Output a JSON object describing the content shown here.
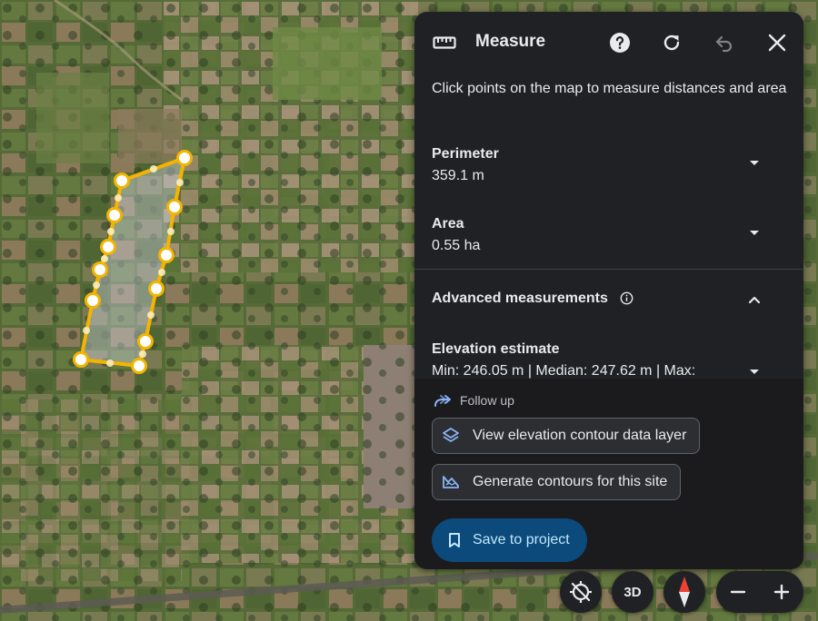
{
  "panel": {
    "title": "Measure",
    "instructions": "Click points on the map to measure distances and area",
    "perimeter": {
      "label": "Perimeter",
      "value": "359.1 m"
    },
    "area": {
      "label": "Area",
      "value": "0.55 ha"
    },
    "advanced": {
      "label": "Advanced measurements"
    },
    "elevation": {
      "label": "Elevation estimate",
      "value": "Min: 246.05 m | Median: 247.62 m | Max:"
    },
    "follow_up": "Follow up",
    "actions": {
      "view_contour": "View elevation contour data layer",
      "generate_contours": "Generate contours for this site",
      "save": "Save to project"
    }
  },
  "controls": {
    "three_d": "3D"
  },
  "colors": {
    "panel_bg": "#202124",
    "measure_line": "#f4b400",
    "save_button": "#0b4a7a",
    "save_text": "#c2e7ff",
    "compass_red": "#ea4335"
  },
  "icons": [
    "ruler-icon",
    "help-icon",
    "refresh-icon",
    "undo-icon",
    "close-icon",
    "chevron-down-icon",
    "chevron-up-icon",
    "info-icon",
    "follow-up-icon",
    "layers-icon",
    "contour-icon",
    "bookmark-icon",
    "location-off-icon",
    "compass-icon",
    "zoom-out-icon",
    "zoom-in-icon"
  ]
}
